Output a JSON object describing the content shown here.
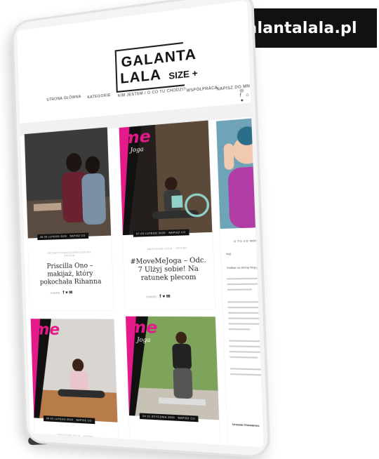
{
  "handle": "@galantalala.pl",
  "logo": {
    "line1": "GALANTA",
    "line2": "LALA",
    "size": "SIZE +"
  },
  "nav": {
    "items": [
      "STRONA GŁÓWNA",
      "KATEGORIE",
      "KIM JESTEM / O CO TU CHODZI?",
      "WSPÓŁPRACA",
      "NAPISZ DO MNIE"
    ]
  },
  "social": {
    "icons": "◎ f ⌂ ✦"
  },
  "posts": [
    {
      "date": "08 05 LUTEGO 2020",
      "comments": "NAPISZ CO",
      "category": "#STARTTOWARDSRECOVERY",
      "category2": "URODA",
      "title": "Priscilla Ono – makijaż, który pokochała Rihanna",
      "share_label": "SHARE:"
    },
    {
      "date": "07 03 LUTEGO 2020",
      "comments": "NAPISZ CO",
      "category": "#MOVEMEJOGA",
      "category2": "SPORT",
      "title": "#MoveMeJoga – Odc. 7 Ulżyj sobie! Na ratunek plecom",
      "share_label": "SHARE:"
    },
    {
      "date": "05 02 LUTEGO 2020",
      "comments": "NAPISZ CO",
      "category": "#MOVEMEJOGA",
      "category2": "SPORT",
      "title": "",
      "share_label": ""
    },
    {
      "date": "04 31 STYCZNIA 2020",
      "comments": "NAPISZ CO",
      "category": "",
      "category2": "",
      "title": "",
      "share_label": ""
    }
  ],
  "sidebar": {
    "label": "O TO CO MNIE JEST",
    "hello": "Hej!",
    "p1": "Trafiłaś na stronę blog plus size.",
    "p2": "Tak się nazywa moja pasja.",
    "signature": "Urszula Chowaniec"
  },
  "yoga_brand": {
    "word1": "me",
    "word2": "Joga"
  }
}
